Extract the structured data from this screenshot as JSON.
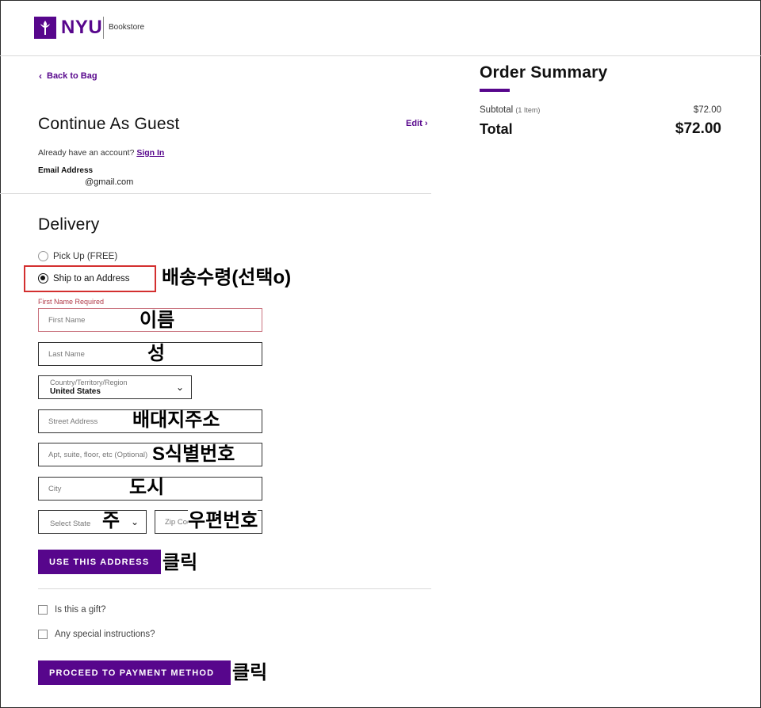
{
  "header": {
    "brand": "NYU",
    "sub": "Bookstore"
  },
  "nav": {
    "back_label": "Back to Bag"
  },
  "guest": {
    "title": "Continue As Guest",
    "edit_label": "Edit",
    "account_prompt": "Already have an account?",
    "signin_label": "Sign In",
    "email_label": "Email Address",
    "email_value": "@gmail.com"
  },
  "delivery": {
    "title": "Delivery",
    "options": [
      {
        "label": "Pick Up (FREE)",
        "checked": false
      },
      {
        "label": "Ship to an Address",
        "checked": true
      }
    ],
    "first_name_error": "First Name Required",
    "fields": {
      "first_name": "First Name",
      "last_name": "Last Name",
      "country_label": "Country/Territory/Region",
      "country_value": "United States",
      "street": "Street Address",
      "apt": "Apt, suite, floor, etc (Optional)",
      "city": "City",
      "state": "Select State",
      "zip": "Zip Code"
    },
    "use_address_button": "USE THIS ADDRESS",
    "gift_label": "Is this a gift?",
    "instructions_label": "Any special instructions?",
    "payment_button": "PROCEED TO PAYMENT METHOD"
  },
  "annotations": {
    "ship": "배송수령(선택o)",
    "first_name": "이름",
    "last_name": "성",
    "street": "배대지주소",
    "apt": "S식별번호",
    "city": "도시",
    "state": "주",
    "zip": "우편번호",
    "click1": "클릭",
    "click2": "클릭"
  },
  "summary": {
    "title": "Order Summary",
    "subtotal_label": "Subtotal",
    "item_count": "(1 Item)",
    "subtotal_value": "$72.00",
    "total_label": "Total",
    "total_value": "$72.00"
  },
  "colors": {
    "brand": "#57068c",
    "highlight": "#d32f2f",
    "error": "#b03a48"
  }
}
